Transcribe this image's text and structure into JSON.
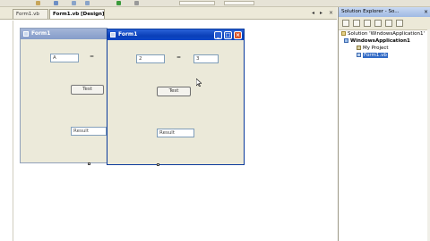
{
  "tabs": {
    "tab1": "Form1.vb",
    "tab2": "Form1.vb [Design]"
  },
  "tab_controls": {
    "left": "◂",
    "right": "▸",
    "close": "×"
  },
  "form_back": {
    "title": "Form1",
    "textbox_a": "A",
    "equals": "=",
    "button": "Test",
    "result_box": "Result"
  },
  "form_front": {
    "title": "Form1",
    "textbox_1": "2",
    "equals": "=",
    "textbox_2": "3",
    "button": "Test",
    "result_box": "Result",
    "caption_min": "_",
    "caption_max": "□",
    "caption_close": "×"
  },
  "solution_explorer": {
    "title": "Solution Explorer - So...",
    "close": "×",
    "items": {
      "solution": "Solution 'WindowsApplication1'",
      "project": "WindowsApplication1",
      "my_project": "My Project",
      "form1": "Form1.vb"
    }
  },
  "icons": [
    "save-icon",
    "open-icon",
    "undo-icon",
    "redo-icon",
    "start-debug-icon",
    "find-icon",
    "properties-icon",
    "refresh-icon",
    "view-code-icon",
    "view-designer-icon",
    "project-icon",
    "folder-icon",
    "form-file-icon",
    "cursor-icon"
  ]
}
